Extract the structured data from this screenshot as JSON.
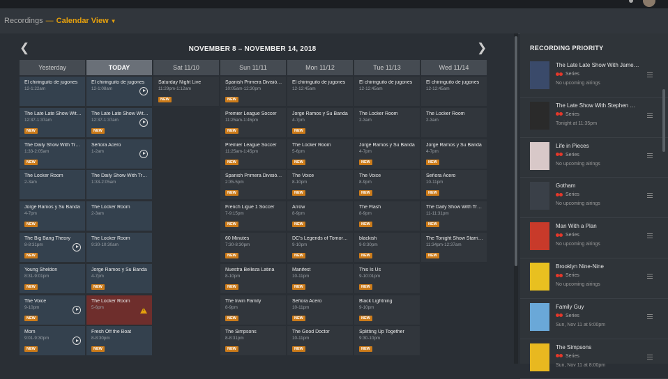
{
  "breadcrumb": {
    "root": "Recordings",
    "separator": "—",
    "view": "Calendar View"
  },
  "week": {
    "title": "NOVEMBER 8 – NOVEMBER 14, 2018"
  },
  "days": [
    {
      "label": "Yesterday",
      "kind": "past",
      "cells": [
        {
          "title": "El chiringuito de jugones",
          "time": "12-1:22am"
        },
        {
          "title": "The Late Late Show With James Corden",
          "time": "12:37-1:37am",
          "badge": "NEW"
        },
        {
          "title": "The Daily Show With Trevor Noah",
          "time": "1:33-2:05am",
          "badge": "NEW"
        },
        {
          "title": "The Locker Room",
          "time": "2-3am"
        },
        {
          "title": "Jorge Ramos y Su Banda",
          "time": "4-7pm",
          "badge": "NEW"
        },
        {
          "title": "The Big Bang Theory",
          "time": "8-8:31pm",
          "badge": "NEW",
          "play": true
        },
        {
          "title": "Young Sheldon",
          "time": "8:31-9:01pm",
          "badge": "NEW"
        },
        {
          "title": "The Voice",
          "time": "9-10pm",
          "badge": "NEW",
          "play": true
        },
        {
          "title": "Mom",
          "time": "9:01-9:30pm",
          "badge": "NEW",
          "play": true
        }
      ]
    },
    {
      "label": "TODAY",
      "kind": "today",
      "cells": [
        {
          "title": "El chiringuito de jugones",
          "time": "12-1:08am",
          "play": true
        },
        {
          "title": "The Late Late Show With James Corden",
          "time": "12:37-1:37am",
          "badge": "NEW",
          "play": true
        },
        {
          "title": "Señora Acero",
          "time": "1-2am",
          "play": true
        },
        {
          "title": "The Daily Show With Trevor Noah",
          "time": "1:33-2:05am"
        },
        {
          "title": "The Locker Room",
          "time": "2-3am"
        },
        {
          "title": "The Locker Room",
          "time": "9:30-10:30am"
        },
        {
          "title": "Jorge Ramos y Su Banda",
          "time": "4-7pm",
          "badge": "NEW"
        },
        {
          "title": "The Locker Room",
          "time": "5-6pm",
          "alert": true
        },
        {
          "title": "Fresh Off the Boat",
          "time": "8-8:30pm",
          "badge": "NEW"
        }
      ]
    },
    {
      "label": "Sat 11/10",
      "kind": "future",
      "cells": [
        {
          "title": "Saturday Night Live",
          "time": "11:29pm-1:12am",
          "badge": "NEW"
        }
      ]
    },
    {
      "label": "Sun 11/11",
      "kind": "future",
      "cells": [
        {
          "title": "Spanish Primera División Soccer",
          "time": "10:05am-12:30pm",
          "badge": "NEW"
        },
        {
          "title": "Premier League Soccer",
          "time": "11:25am-1:45pm",
          "badge": "NEW"
        },
        {
          "title": "Premier League Soccer",
          "time": "11:25am-1:45pm",
          "badge": "NEW"
        },
        {
          "title": "Spanish Primera División Soccer",
          "time": "2:35-5pm",
          "badge": "NEW"
        },
        {
          "title": "French Ligue 1 Soccer",
          "time": "7-9:15pm",
          "badge": "NEW"
        },
        {
          "title": "60 Minutes",
          "time": "7:30-8:30pm",
          "badge": "NEW"
        },
        {
          "title": "Nuestra Belleza Latina",
          "time": "8-10pm",
          "badge": "NEW"
        },
        {
          "title": "The Irwin Family",
          "time": "8-9pm",
          "badge": "NEW"
        },
        {
          "title": "The Simpsons",
          "time": "8-8:31pm",
          "badge": "NEW"
        }
      ]
    },
    {
      "label": "Mon 11/12",
      "kind": "future",
      "cells": [
        {
          "title": "El chiringuito de jugones",
          "time": "12-12:45am"
        },
        {
          "title": "Jorge Ramos y Su Banda",
          "time": "4-7pm",
          "badge": "NEW"
        },
        {
          "title": "The Locker Room",
          "time": "5-6pm",
          "badge": "NEW"
        },
        {
          "title": "The Voice",
          "time": "8-10pm",
          "badge": "NEW"
        },
        {
          "title": "Arrow",
          "time": "8-9pm",
          "badge": "NEW"
        },
        {
          "title": "DC's Legends of Tomorrow",
          "time": "9-10pm",
          "badge": "NEW"
        },
        {
          "title": "Manifest",
          "time": "10-11pm",
          "badge": "NEW"
        },
        {
          "title": "Señora Acero",
          "time": "10-11pm",
          "badge": "NEW"
        },
        {
          "title": "The Good Doctor",
          "time": "10-11pm",
          "badge": "NEW"
        }
      ]
    },
    {
      "label": "Tue 11/13",
      "kind": "future",
      "cells": [
        {
          "title": "El chiringuito de jugones",
          "time": "12-12:45am"
        },
        {
          "title": "The Locker Room",
          "time": "2-3am"
        },
        {
          "title": "Jorge Ramos y Su Banda",
          "time": "4-7pm",
          "badge": "NEW"
        },
        {
          "title": "The Voice",
          "time": "8-9pm",
          "badge": "NEW"
        },
        {
          "title": "The Flash",
          "time": "8-9pm",
          "badge": "NEW"
        },
        {
          "title": "blackish",
          "time": "9-9:30pm",
          "badge": "NEW"
        },
        {
          "title": "This Is Us",
          "time": "9-10:01pm",
          "badge": "NEW"
        },
        {
          "title": "Black Lightning",
          "time": "9-10pm",
          "badge": "NEW"
        },
        {
          "title": "Splitting Up Together",
          "time": "9:30-10pm",
          "badge": "NEW"
        }
      ]
    },
    {
      "label": "Wed 11/14",
      "kind": "future",
      "cells": [
        {
          "title": "El chiringuito de jugones",
          "time": "12-12:45am"
        },
        {
          "title": "The Locker Room",
          "time": "2-3am"
        },
        {
          "title": "Jorge Ramos y Su Banda",
          "time": "4-7pm",
          "badge": "NEW"
        },
        {
          "title": "Señora Acero",
          "time": "10-11pm",
          "badge": "NEW"
        },
        {
          "title": "The Daily Show With Trevor Noah",
          "time": "11-11:31pm",
          "badge": "NEW"
        },
        {
          "title": "The Tonight Show Starring Jimmy Fallon",
          "time": "11:34pm-12:37am",
          "badge": "NEW"
        }
      ]
    }
  ],
  "priority": {
    "title": "RECORDING PRIORITY",
    "items": [
      {
        "name": "The Late Late Show With James Corden",
        "type": "Series",
        "next": "No upcoming airings",
        "color": "#3a4a6a"
      },
      {
        "name": "The Late Show With Stephen Colbert",
        "type": "Series",
        "next": "Tonight at 11:35pm",
        "color": "#2a2a2a"
      },
      {
        "name": "Life in Pieces",
        "type": "Series",
        "next": "No upcoming airings",
        "color": "#d8c8c8"
      },
      {
        "name": "Gotham",
        "type": "Series",
        "next": "No upcoming airings",
        "color": "#3a4048"
      },
      {
        "name": "Man With a Plan",
        "type": "Series",
        "next": "No upcoming airings",
        "color": "#c83a2a"
      },
      {
        "name": "Brooklyn Nine-Nine",
        "type": "Series",
        "next": "No upcoming airings",
        "color": "#e8c020"
      },
      {
        "name": "Family Guy",
        "type": "Series",
        "next": "Sun, Nov 11 at 9:00pm",
        "color": "#6aa8d8"
      },
      {
        "name": "The Simpsons",
        "type": "Series",
        "next": "Sun, Nov 11 at 8:00pm",
        "color": "#e8b820"
      }
    ]
  },
  "icons": {
    "prev": "chevron-left-icon",
    "next": "chevron-right-icon",
    "play": "play-circle-icon",
    "warning": "warning-icon",
    "drag": "drag-handle-icon"
  },
  "colors": {
    "accent": "#e5a00d",
    "badge": "#cc7b19",
    "alert": "#6e2e2c"
  }
}
